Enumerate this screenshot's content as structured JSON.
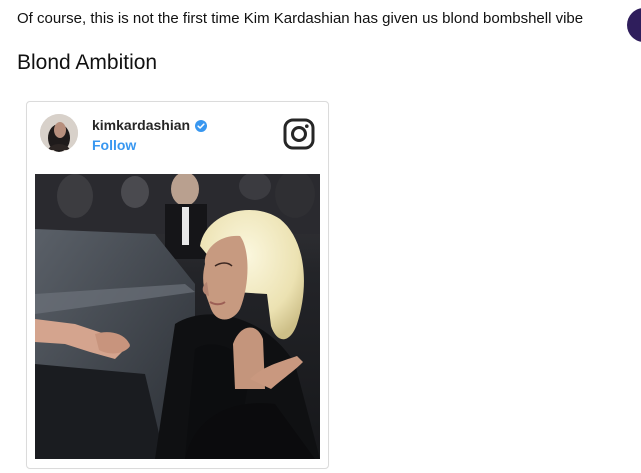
{
  "article": {
    "intro_text": "Of course, this is not the first time Kim Kardashian has given us blond bombshell vibe",
    "section_heading": "Blond Ambition"
  },
  "embed": {
    "username": "kimkardashian",
    "follow_label": "Follow",
    "verified": true,
    "brand_color": "#3897f0",
    "icons": [
      "verified-icon",
      "instagram-icon"
    ]
  }
}
